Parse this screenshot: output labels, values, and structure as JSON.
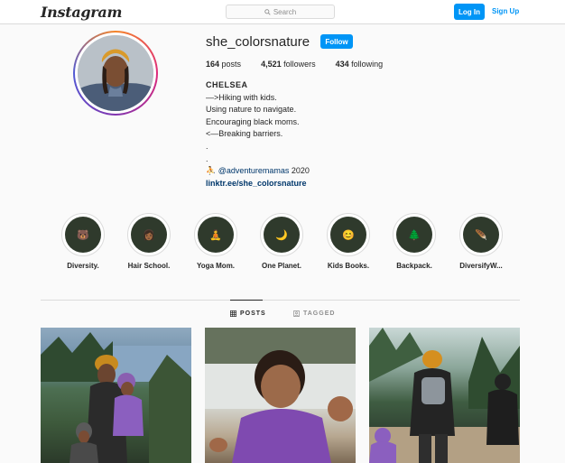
{
  "topbar": {
    "logo": "Instagram",
    "search_placeholder": "Search",
    "login_label": "Log In",
    "signup_label": "Sign Up"
  },
  "profile": {
    "username": "she_colorsnature",
    "follow_label": "Follow",
    "stats": {
      "posts_count": "164",
      "posts_label": "posts",
      "followers_count": "4,521",
      "followers_label": "followers",
      "following_count": "434",
      "following_label": "following"
    },
    "bio": {
      "name": "CHELSEA",
      "lines": [
        "—>Hiking with kids.",
        "Using nature to navigate.",
        "Encouraging black moms.",
        "<—Breaking barriers.",
        ".",
        "."
      ],
      "mention_prefix": "⛹ ",
      "mention": "@adventuremamas",
      "mention_suffix": " 2020",
      "link": "linktr.ee/she_colorsnature"
    }
  },
  "highlights": [
    {
      "label": "Diversity.",
      "emoji": "🐻",
      "icon": "bear-icon"
    },
    {
      "label": "Hair School.",
      "emoji": "👩🏾",
      "icon": "hair-icon"
    },
    {
      "label": "Yoga Mom.",
      "emoji": "🧘",
      "icon": "yoga-icon"
    },
    {
      "label": "One Planet.",
      "emoji": "🌙",
      "icon": "moon-icon"
    },
    {
      "label": "Kids Books.",
      "emoji": "😊",
      "icon": "smiley-icon"
    },
    {
      "label": "Backpack.",
      "emoji": "🌲",
      "icon": "tree-icon"
    },
    {
      "label": "DiversifyW...",
      "emoji": "🪶",
      "icon": "feather-icon"
    }
  ],
  "tabs": {
    "posts_label": "POSTS",
    "tagged_label": "TAGGED"
  },
  "colors": {
    "accent": "#0095f6",
    "link": "#00376b",
    "text": "#262626",
    "muted": "#8e8e8e"
  }
}
